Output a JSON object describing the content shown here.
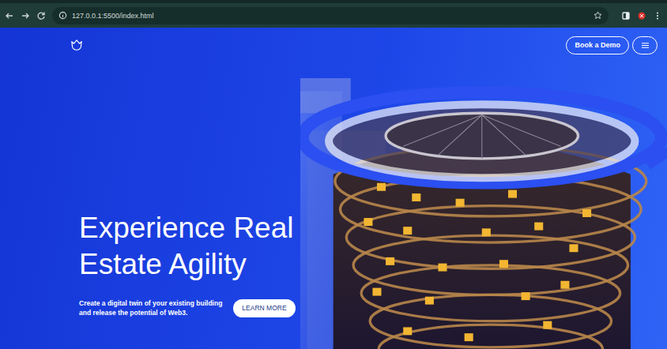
{
  "browser": {
    "address": "127.0.0.1:5500/index.html"
  },
  "nav": {
    "demo_button": "Book a Demo"
  },
  "hero": {
    "title_lines": [
      "Experience Real",
      "Estate Agility"
    ],
    "subtitle_lines": [
      "Create a digital twin of your existing building",
      "and release the potential of Web3."
    ],
    "cta": "LEARN MORE"
  }
}
